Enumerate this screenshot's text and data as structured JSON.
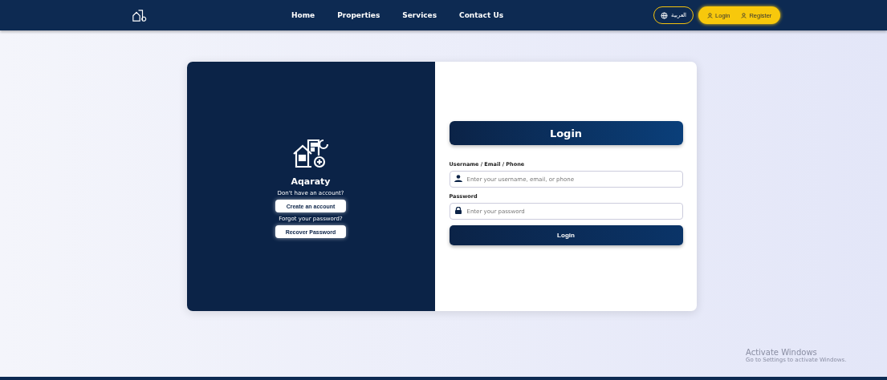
{
  "navbar": {
    "links": [
      "Home",
      "Properties",
      "Services",
      "Contact Us"
    ],
    "language": "العربية",
    "auth": [
      "Login",
      "Register"
    ]
  },
  "side": {
    "brand": "Aqaraty",
    "no_account": "Don't have an account?",
    "create": "Create an account",
    "forgot": "Forgot your password?",
    "recover": "Recover Password"
  },
  "form": {
    "title": "Login",
    "fields": [
      {
        "kind": "user",
        "label": "Username / Email / Phone",
        "placeholder": "Enter your username, email, or phone"
      },
      {
        "kind": "lock",
        "label": "Password",
        "placeholder": "Enter your password"
      }
    ],
    "submit": "Login"
  },
  "watermark": {
    "title": "Activate Windows",
    "subtitle": "Go to Settings to activate Windows."
  }
}
